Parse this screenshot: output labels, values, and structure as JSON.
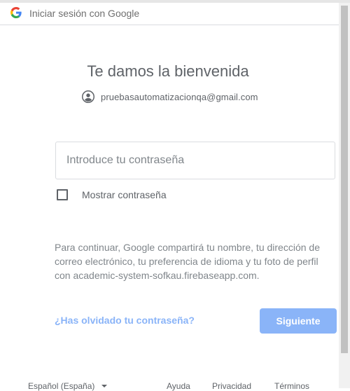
{
  "window": {
    "title": "Iniciar sesión con Google"
  },
  "main": {
    "heading": "Te damos la bienvenida",
    "account_email": "pruebasautomatizacionqa@gmail.com",
    "password_placeholder": "Introduce tu contraseña",
    "password_value": "",
    "show_password_label": "Mostrar contraseña",
    "show_password_checked": false,
    "disclaimer": "Para continuar, Google compartirá tu nombre, tu dirección de correo electrónico, tu preferencia de idioma y tu foto de perfil con academic-system-sofkau.firebaseapp.com.",
    "forgot_password": "¿Has olvidado tu contraseña?",
    "next_button": "Siguiente"
  },
  "footer": {
    "language": "Español (España)",
    "help": "Ayuda",
    "privacy": "Privacidad",
    "terms": "Términos"
  },
  "colors": {
    "accent_disabled": "#8ab4f8",
    "text_secondary": "#5f6368",
    "border": "#dadce0"
  },
  "icons": {
    "title": "google-g-icon",
    "account": "account-circle-icon",
    "language": "dropdown-caret-icon"
  }
}
